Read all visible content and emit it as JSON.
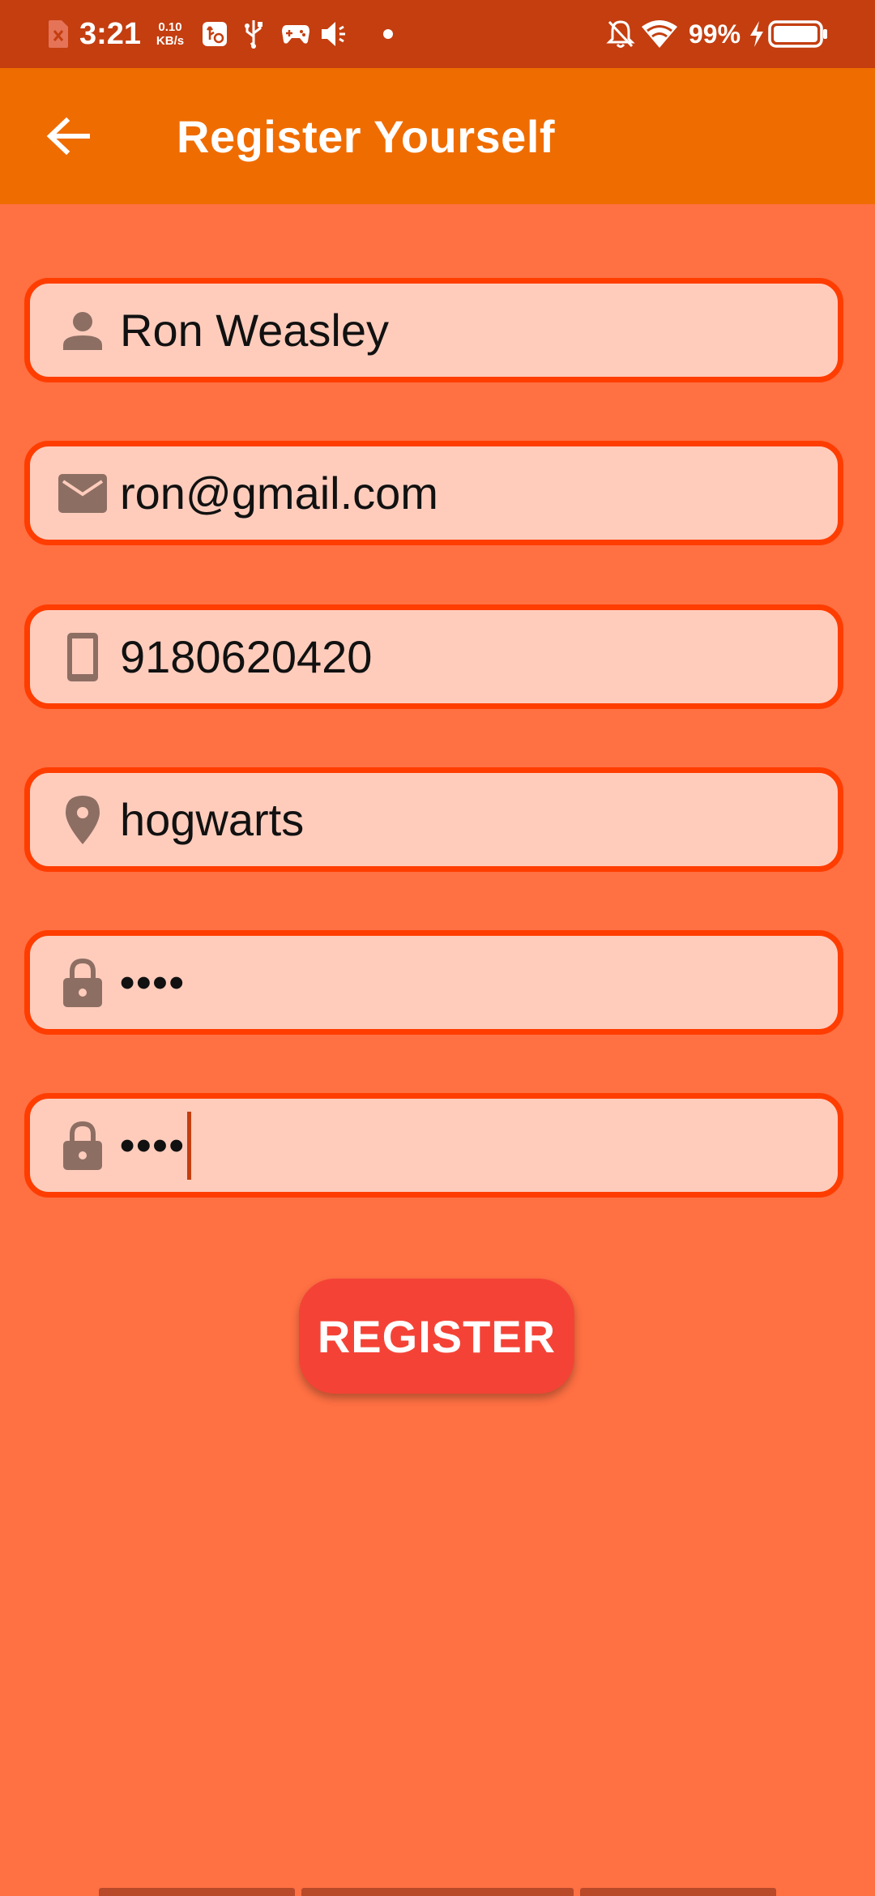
{
  "status_bar": {
    "time": "3:21",
    "net_speed_value": "0.10",
    "net_speed_unit": "KB/s",
    "battery_text": "99%",
    "icons": [
      "sim-error-icon",
      "usb-settings-icon",
      "usb-icon",
      "gamepad-icon",
      "volume-icon",
      "dot-icon",
      "bell-off-icon",
      "wifi-icon",
      "charging-icon",
      "battery-icon"
    ]
  },
  "app_bar": {
    "title": "Register Yourself",
    "back_icon": "arrow-left-icon"
  },
  "form": {
    "name": {
      "value": "Ron Weasley",
      "icon": "person-icon"
    },
    "email": {
      "value": "ron@gmail.com",
      "icon": "mail-icon"
    },
    "phone": {
      "value": "9180620420",
      "icon": "phone-icon"
    },
    "address": {
      "value": "hogwarts",
      "icon": "location-icon"
    },
    "password": {
      "value": "••••",
      "icon": "lock-icon"
    },
    "confirm_password": {
      "value": "••••",
      "icon": "lock-icon"
    }
  },
  "register_button": {
    "label": "REGISTER"
  },
  "colors": {
    "status_bar": "#C43E10",
    "app_bar": "#EF6C00",
    "background": "#FF7043",
    "field_fill": "#FFCCBC",
    "field_border": "#FF3D00",
    "button": "#F44336",
    "icon": "#8D6E63"
  }
}
